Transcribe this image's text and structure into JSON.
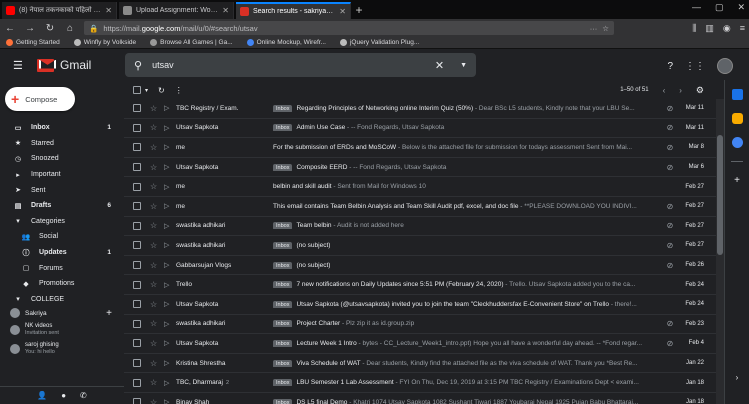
{
  "browser": {
    "tabs": [
      {
        "title": "(8) नेपाल तकनकाको पहिलो विदे",
        "favicon_color": "#ff0000",
        "active": false
      },
      {
        "title": "Upload Assignment: Work In P",
        "favicon_color": "#8a8a8a",
        "active": false
      },
      {
        "title": "Search results - sakriya33@gm",
        "favicon_color": "#d93025",
        "active": true
      }
    ],
    "new_tab": "+",
    "url_prefix": "https://mail.",
    "url_domain": "google.com",
    "url_path": "/mail/u/0/#search/utsav",
    "url_menu": "···",
    "bookmarks": [
      {
        "label": "Getting Started",
        "color": "#ff7139"
      },
      {
        "label": "Winfly by Volkside",
        "color": "#bbbbbb"
      },
      {
        "label": "Browse All Games | Ga...",
        "color": "#999999"
      },
      {
        "label": "Online Mockup, Wirefr...",
        "color": "#4285f4"
      },
      {
        "label": "jQuery Validation Plug...",
        "color": "#bbbbbb"
      }
    ]
  },
  "gmail": {
    "app_name": "Gmail",
    "search_value": "utsav",
    "compose_label": "Compose",
    "nav": [
      {
        "icon": "▭",
        "icon_name": "inbox-icon",
        "label": "Inbox",
        "count": "1",
        "bold": true,
        "key": "inbox"
      },
      {
        "icon": "★",
        "icon_name": "star-icon",
        "label": "Starred",
        "count": "",
        "bold": false,
        "key": "starred"
      },
      {
        "icon": "◷",
        "icon_name": "clock-icon",
        "label": "Snoozed",
        "count": "",
        "bold": false,
        "key": "snoozed"
      },
      {
        "icon": "▸",
        "icon_name": "important-icon",
        "label": "Important",
        "count": "",
        "bold": false,
        "key": "important"
      },
      {
        "icon": "➤",
        "icon_name": "send-icon",
        "label": "Sent",
        "count": "",
        "bold": false,
        "key": "sent"
      },
      {
        "icon": "▤",
        "icon_name": "draft-icon",
        "label": "Drafts",
        "count": "6",
        "bold": true,
        "key": "drafts"
      },
      {
        "icon": "▾",
        "icon_name": "label-icon",
        "label": "Categories",
        "count": "",
        "bold": false,
        "key": "categories"
      },
      {
        "icon": "👥",
        "icon_name": "social-icon",
        "label": "Social",
        "count": "",
        "bold": false,
        "key": "social",
        "sub": true
      },
      {
        "icon": "ⓘ",
        "icon_name": "updates-icon",
        "label": "Updates",
        "count": "1",
        "bold": true,
        "key": "updates",
        "sub": true
      },
      {
        "icon": "▢",
        "icon_name": "forums-icon",
        "label": "Forums",
        "count": "",
        "bold": false,
        "key": "forums",
        "sub": true
      },
      {
        "icon": "◆",
        "icon_name": "promotions-icon",
        "label": "Promotions",
        "count": "",
        "bold": false,
        "key": "promotions",
        "sub": true
      },
      {
        "icon": "▾",
        "icon_name": "label-icon",
        "label": "COLLEGE",
        "count": "",
        "bold": false,
        "key": "college"
      }
    ],
    "hangouts": {
      "user": "Sakriya",
      "contacts": [
        {
          "name": "NK videos",
          "status": "Invitation sent"
        },
        {
          "name": "saroj ghising",
          "status": "You: hi hello"
        }
      ]
    },
    "pager": "1–50 of 51",
    "rows": [
      {
        "sender": "TBC Registry / Exam.",
        "count": "",
        "badge": "Inbox",
        "subject": "Regarding Principles of Networking online Interim Quiz (50%)",
        "snippet": " - Dear BSc L5 students, Kindly note that your LBU Se...",
        "date": "Mar 11",
        "attach": true
      },
      {
        "sender": "Utsav Sapkota",
        "count": "",
        "badge": "Inbox",
        "subject": "Admin Use Case",
        "snippet": " - -- Fond Regards, Utsav Sapkota",
        "date": "Mar 11",
        "attach": true
      },
      {
        "sender": "me",
        "count": "",
        "badge": "",
        "subject": "For the submission of ERDs and MoSCoW",
        "snippet": " - Below is the attached file for submission for todays assessment Sent from Mai...",
        "date": "Mar 8",
        "attach": true
      },
      {
        "sender": "Utsav Sapkota",
        "count": "",
        "badge": "Inbox",
        "subject": "Composite EERD",
        "snippet": " - -- Fond Regards, Utsav Sapkota",
        "date": "Mar 6",
        "attach": true
      },
      {
        "sender": "me",
        "count": "",
        "badge": "",
        "subject": "belbin and skill audit",
        "snippet": " - Sent from Mail for Windows 10",
        "date": "Feb 27",
        "attach": false
      },
      {
        "sender": "me",
        "count": "",
        "badge": "",
        "subject": "This email contains Team Belbin Analysis and Team Skill Audit pdf, excel, and doc file",
        "snippet": " - **PLEASE DOWNLOAD YOU INDIVI...",
        "date": "Feb 27",
        "attach": true
      },
      {
        "sender": "swastika adhikari",
        "count": "",
        "badge": "Inbox",
        "subject": "Team belbin",
        "snippet": " - Audit is not added here",
        "date": "Feb 27",
        "attach": true
      },
      {
        "sender": "swastika adhikari",
        "count": "",
        "badge": "Inbox",
        "subject": "(no subject)",
        "snippet": "",
        "date": "Feb 27",
        "attach": true
      },
      {
        "sender": "Gabbarsujan Vlogs",
        "count": "",
        "badge": "Inbox",
        "subject": "(no subject)",
        "snippet": "",
        "date": "Feb 26",
        "attach": true
      },
      {
        "sender": "Trello",
        "count": "",
        "badge": "Inbox",
        "subject": "7 new notifications on Daily Updates since 5:51 PM (February 24, 2020)",
        "snippet": " - Trello. Utsav Sapkota added you to the ca...",
        "date": "Feb 24",
        "attach": false
      },
      {
        "sender": "Utsav Sapkota",
        "count": "",
        "badge": "Inbox",
        "subject": "Utsav Sapkota (@utsavsapkota) invited you to join the team \"Cleckhuddersfax E-Convenient Store\" on Trello",
        "snippet": " - there!...",
        "date": "Feb 24",
        "attach": false
      },
      {
        "sender": "swastika adhikari",
        "count": "",
        "badge": "Inbox",
        "subject": "Project Charter",
        "snippet": " - Plz zip it as id.group.zip",
        "date": "Feb 23",
        "attach": true
      },
      {
        "sender": "Utsav Sapkota",
        "count": "",
        "badge": "Inbox",
        "subject": "Lecture Week 1 Intro",
        "snippet": " - bytes - CC_Lecture_Week1_intro.ppt) Hope you all have a wonderful day ahead. -- *Fond regar...",
        "date": "Feb 4",
        "attach": true
      },
      {
        "sender": "Kristina Shrestha",
        "count": "",
        "badge": "Inbox",
        "subject": "Viva Schedule of WAT",
        "snippet": " - Dear students, Kindly find the attached file as the viva schedule of WAT. Thank you *Best Re...",
        "date": "Jan 22",
        "attach": false
      },
      {
        "sender": "TBC, Dharmaraj",
        "count": "2",
        "badge": "Inbox",
        "subject": "LBU Semester 1 Lab Assessment",
        "snippet": " - FYI On Thu, Dec 19, 2019 at 3:15 PM TBC Registry / Examinations Dept < exami...",
        "date": "Jan 18",
        "attach": false
      },
      {
        "sender": "Binay Shah",
        "count": "",
        "badge": "Inbox",
        "subject": "DS L5 final Demo",
        "snippet": " - Khatri 1074 Utsav Sapkota 1082 Sushant Tiwari 1887 Youbaraj Nepal 1925 Pujan Babu Bhattarai...",
        "date": "Jan 18",
        "attach": false
      }
    ]
  },
  "colors": {
    "accent": "#0a84ff",
    "gmail_red": "#d93025",
    "background": "#202124"
  }
}
